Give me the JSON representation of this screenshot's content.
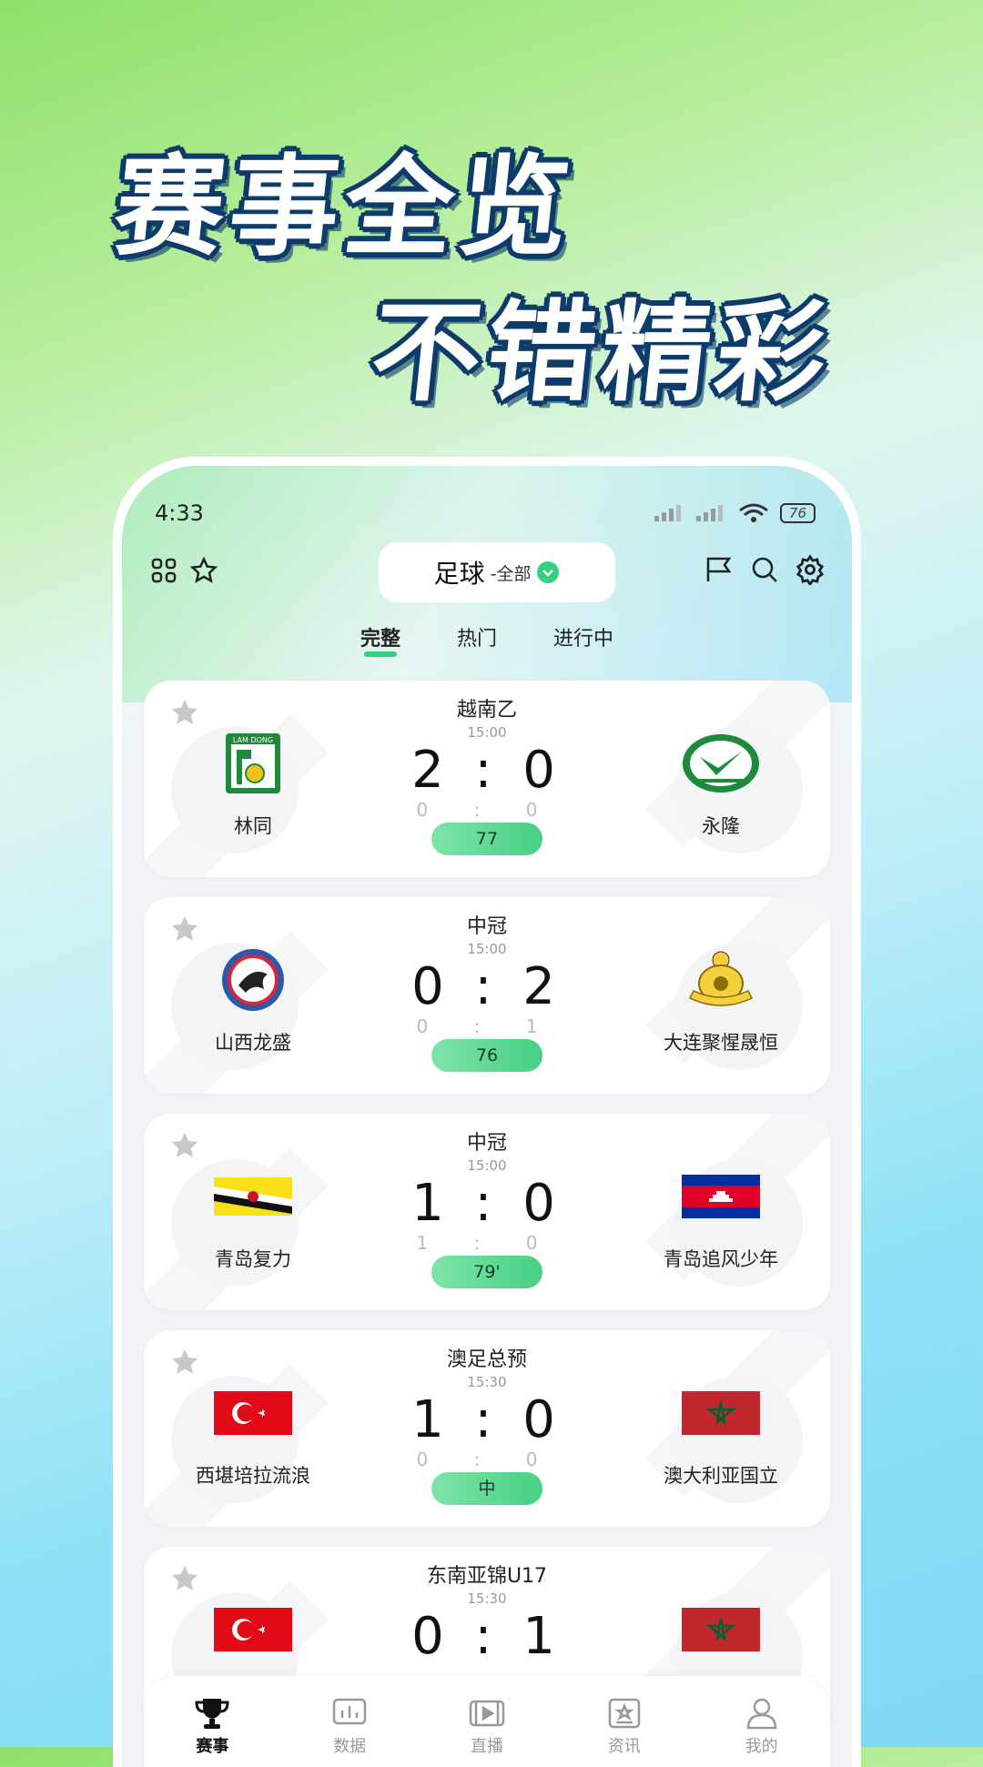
{
  "headline": {
    "line1": "赛事全览",
    "line2": "不错精彩"
  },
  "status": {
    "time": "4:33",
    "battery": "76"
  },
  "topbar": {
    "sport": "足球",
    "filter": "-全部"
  },
  "tabs": [
    "完整",
    "热门",
    "进行中"
  ],
  "matches": [
    {
      "league": "越南乙",
      "time": "15:00",
      "score": "2 : 0",
      "half": "0 : 0",
      "minute": "77",
      "home": "林同",
      "away": "永隆"
    },
    {
      "league": "中冠",
      "time": "15:00",
      "score": "0 : 2",
      "half": "0 : 1",
      "minute": "76",
      "home": "山西龙盛",
      "away": "大连聚惺晟恒"
    },
    {
      "league": "中冠",
      "time": "15:00",
      "score": "1 : 0",
      "half": "1 : 0",
      "minute": "79'",
      "home": "青岛复力",
      "away": "青岛追风少年"
    },
    {
      "league": "澳足总预",
      "time": "15:30",
      "score": "1 : 0",
      "half": "0 : 0",
      "minute": "中",
      "home": "西堪培拉流浪",
      "away": "澳大利亚国立"
    },
    {
      "league": "东南亚锦U17",
      "time": "15:30",
      "score": "0 : 1"
    }
  ],
  "nav": [
    "赛事",
    "数据",
    "直播",
    "资讯",
    "我的"
  ],
  "colors": {
    "accent": "#33d07f",
    "headline_outline": "#0d3b6b"
  }
}
